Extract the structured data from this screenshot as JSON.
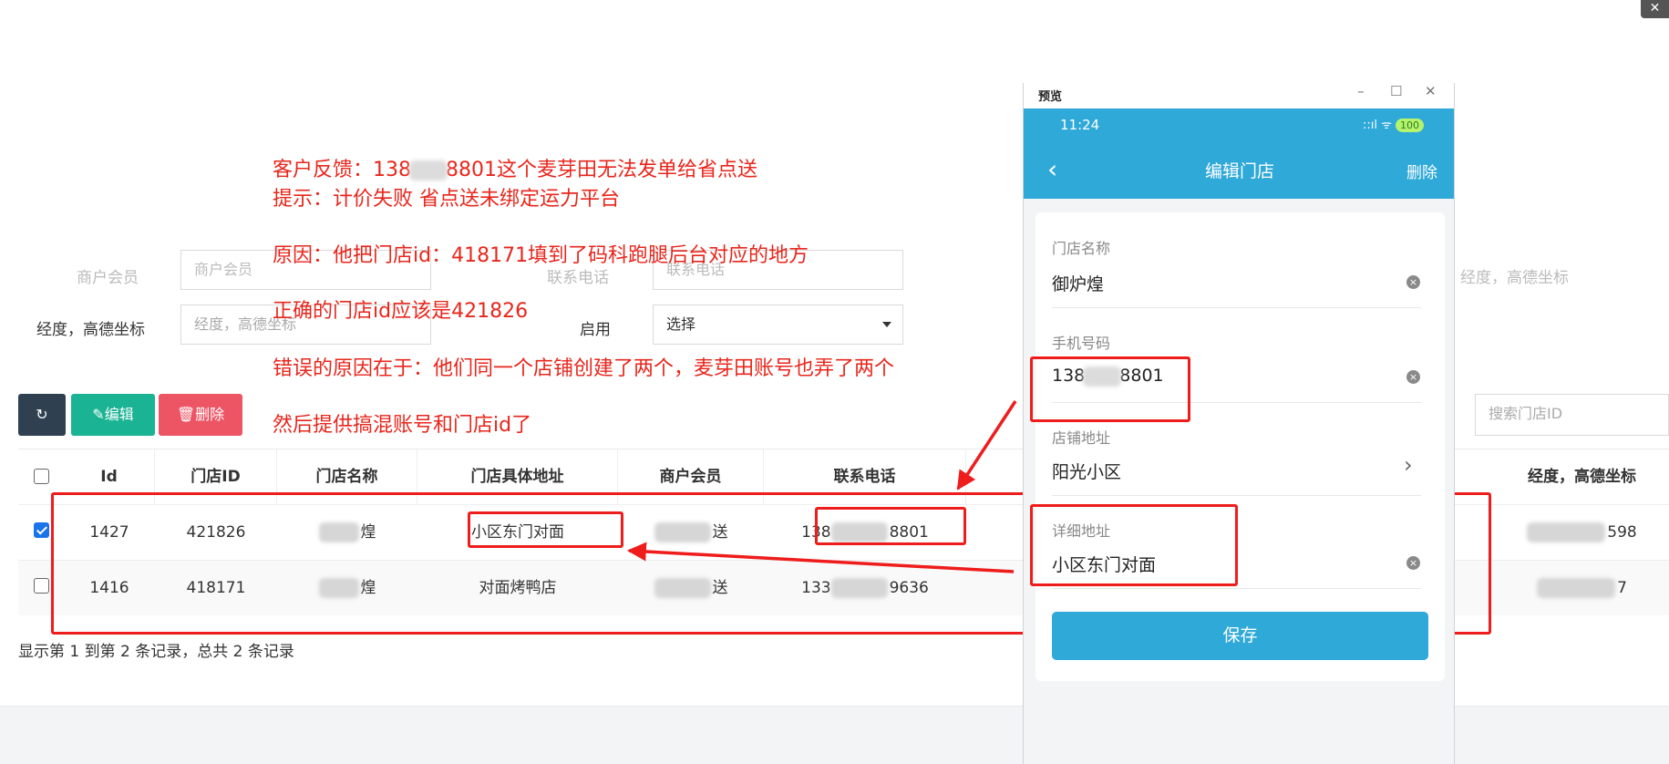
{
  "window": {
    "close_glyph": "✕"
  },
  "form": {
    "row1": {
      "label_a": "商户会员",
      "placeholder_a": "商户会员",
      "label_b": "联系电话",
      "placeholder_b": "联系电话",
      "label_c": "经度，高德坐标"
    },
    "row2": {
      "label_lng": "经度，高德坐标",
      "placeholder_lng": "经度，高德坐标",
      "label_enabled": "启用",
      "select_value": "选择"
    }
  },
  "toolbar": {
    "refresh_icon": "↻",
    "edit_label": "✎编辑",
    "delete_label": "🗑删除",
    "search_placeholder": "搜索门店ID"
  },
  "table": {
    "headers": [
      "Id",
      "门店ID",
      "门店名称",
      "门店具体地址",
      "商户会员",
      "联系电话",
      "经度，高德坐标"
    ],
    "rows": [
      {
        "checked": true,
        "id": "1427",
        "store_id": "421826",
        "name_suffix": "煌",
        "address": "小区东门对面",
        "member_suffix": "送",
        "phone_prefix": "138",
        "phone_suffix": "8801",
        "coord_suffix": "598"
      },
      {
        "checked": false,
        "id": "1416",
        "store_id": "418171",
        "name_suffix": "煌",
        "address": "对面烤鸭店",
        "member_suffix": "送",
        "phone_prefix": "133",
        "phone_suffix": "9636",
        "coord_suffix": "7"
      }
    ],
    "summary": "显示第 1 到第 2 条记录，总共 2 条记录"
  },
  "annotations": {
    "line1_prefix": "客户反馈：138",
    "line1_suffix": "8801这个麦芽田无法发单给省点送",
    "line2": "提示：计价失败  省点送未绑定运力平台",
    "line3": "原因：他把门店id：418171填到了码科跑腿后台对应的地方",
    "line4": "正确的门店id应该是421826",
    "line5": "错误的原因在于：他们同一个店铺创建了两个，麦芽田账号也弄了两个",
    "line6": "然后提供搞混账号和门店id了"
  },
  "preview": {
    "title": "预览",
    "win_min": "–",
    "win_max": "☐",
    "win_close": "✕",
    "time": "11:24",
    "signal": "::ıl ᯤ",
    "battery": "100",
    "back": "‹",
    "nav_title": "编辑门店",
    "nav_delete": "删除",
    "fields": {
      "store_name_label": "门店名称",
      "store_name_value": "御炉煌",
      "phone_label": "手机号码",
      "phone_prefix": "138",
      "phone_suffix": "8801",
      "address_label": "店铺地址",
      "address_value": "阳光小区",
      "detail_label": "详细地址",
      "detail_value": "小区东门对面"
    },
    "clear_glyph": "×",
    "chevron": "›",
    "save_label": "保存"
  },
  "colors": {
    "accent": "#2fa9d8",
    "annotation": "#e8261c",
    "edit": "#1ab394",
    "delete": "#ed5565",
    "dark": "#2f4050"
  }
}
